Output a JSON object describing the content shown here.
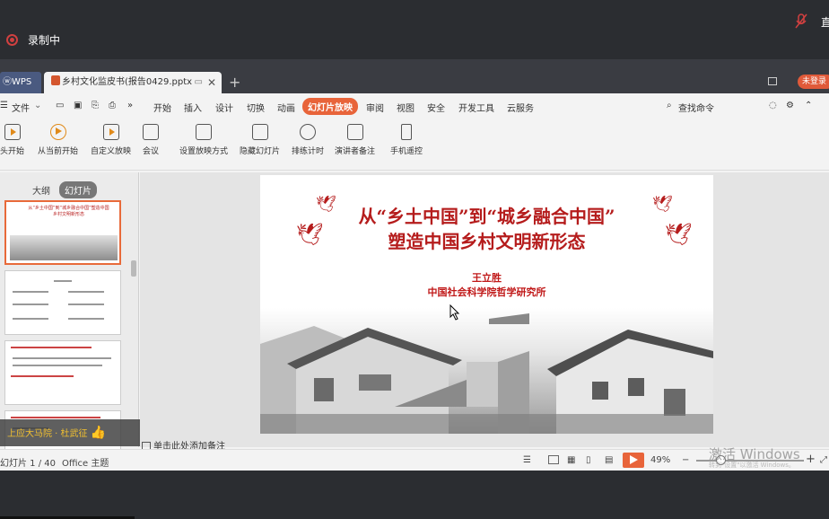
{
  "recording": {
    "label": "录制中",
    "right_text": "直"
  },
  "tabs": {
    "home": "WPS",
    "document": "乡村文化监皮书(报告0429.pptx",
    "add": "+",
    "login": "未登录"
  },
  "menu": {
    "file": "文件",
    "more": "»",
    "items": [
      "开始",
      "插入",
      "设计",
      "切换",
      "动画",
      "幻灯片放映",
      "审阅",
      "视图",
      "安全",
      "开发工具",
      "云服务"
    ],
    "active_index": 5,
    "search": "查找命令"
  },
  "ribbon": {
    "buttons": [
      "头开始",
      "从当前开始",
      "自定义放映",
      "会议",
      "设置放映方式",
      "隐藏幻灯片",
      "排练计时",
      "演讲者备注",
      "手机遥控"
    ]
  },
  "left_panel": {
    "tab_outline": "大纲",
    "tab_slides": "幻灯片",
    "banner": "上应大马院 · 杜武征"
  },
  "slide": {
    "title_line1": "从“乡土中国”到“城乡融合中国”",
    "title_line2": "塑造中国乡村文明新形态",
    "author": "王立胜",
    "organization": "中国社会科学院哲学研究所",
    "thumb1_title": "从“乡土中国”到“城乡融合中国”塑造中国乡村文明新形态"
  },
  "notes": {
    "placeholder": "单击此处添加备注"
  },
  "status": {
    "slide_counter": "幻灯片 1 / 40",
    "theme": "Office 主题",
    "zoom": "49%",
    "zoom_minus": "−",
    "zoom_plus": "+",
    "activation": "激活 Windows",
    "activation_sub": "转到\"设置\"以激活 Windows。"
  },
  "colors": {
    "accent": "#e8643a",
    "title_red": "#b51c1c",
    "recording_red": "#d04040"
  }
}
